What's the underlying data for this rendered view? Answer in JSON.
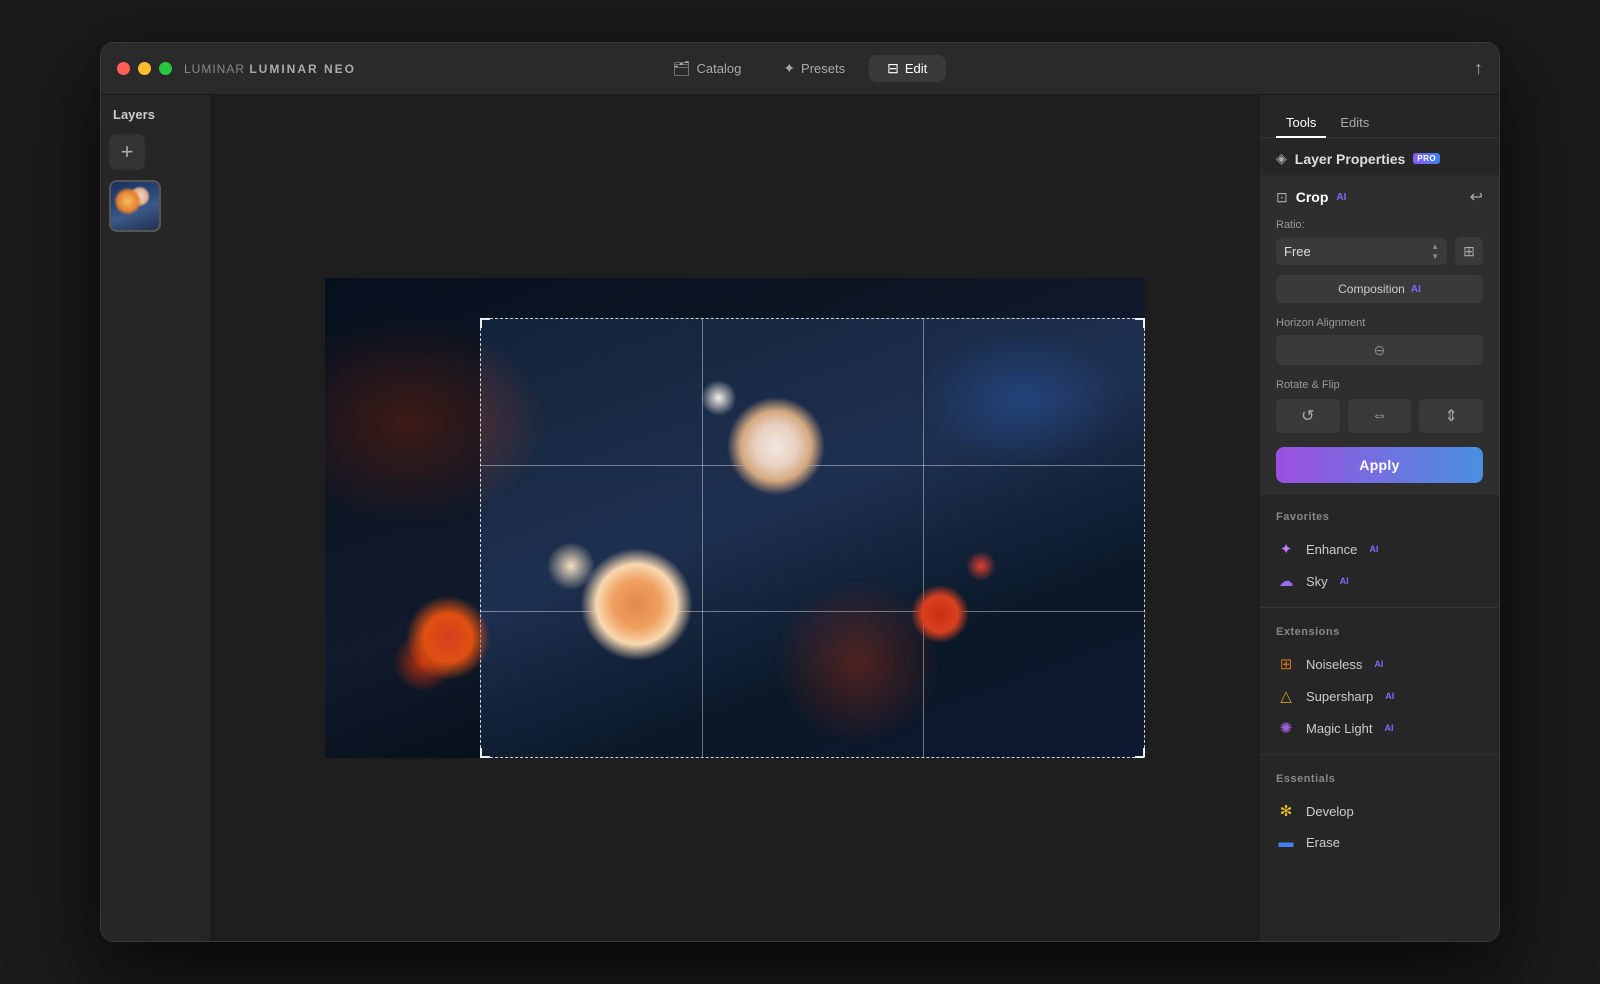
{
  "window": {
    "title": "LUMINAR NEO"
  },
  "titlebar": {
    "app_label": "LUMINAR",
    "app_name": "NEO",
    "nav": [
      {
        "id": "catalog",
        "label": "Catalog",
        "icon": "🗂",
        "active": false
      },
      {
        "id": "presets",
        "label": "Presets",
        "icon": "✦",
        "active": false
      },
      {
        "id": "edit",
        "label": "Edit",
        "icon": "⊟",
        "active": true
      }
    ],
    "share_icon": "↑"
  },
  "layers_panel": {
    "title": "Layers",
    "add_btn_label": "+"
  },
  "right_panel": {
    "tabs": [
      {
        "id": "tools",
        "label": "Tools",
        "active": true
      },
      {
        "id": "edits",
        "label": "Edits",
        "active": false
      }
    ],
    "layer_properties": {
      "title": "Layer Properties",
      "pro_badge": "PRO",
      "icon": "◈"
    },
    "crop": {
      "title": "Crop",
      "ai_badge": "AI",
      "icon": "⊡",
      "reset_icon": "↩",
      "ratio_label": "Ratio:",
      "ratio_value": "Free",
      "composition_label": "Composition",
      "composition_ai": "AI",
      "horizon_label": "Horizon Alignment",
      "rotate_flip_label": "Rotate & Flip",
      "rotate_icon": "↺",
      "flip_h_icon": "⇔",
      "flip_v_icon": "⇕",
      "apply_label": "Apply"
    },
    "favorites": {
      "title": "Favorites",
      "items": [
        {
          "id": "enhance",
          "label": "Enhance",
          "ai": true,
          "icon": "✦",
          "icon_color": "#c87aff"
        },
        {
          "id": "sky",
          "label": "Sky",
          "ai": true,
          "icon": "☁",
          "icon_color": "#9b6aee"
        }
      ]
    },
    "extensions": {
      "title": "Extensions",
      "items": [
        {
          "id": "noiseless",
          "label": "Noiseless",
          "ai": true,
          "icon": "⊞",
          "icon_color": "#c87020"
        },
        {
          "id": "supersharp",
          "label": "Supersharp",
          "ai": true,
          "icon": "△",
          "icon_color": "#d4a020"
        },
        {
          "id": "magic_light",
          "label": "Magic Light",
          "ai": true,
          "icon": "✺",
          "icon_color": "#a060e0"
        }
      ]
    },
    "essentials": {
      "title": "Essentials",
      "items": [
        {
          "id": "develop",
          "label": "Develop",
          "ai": false,
          "icon": "✻",
          "icon_color": "#f0c020"
        },
        {
          "id": "erase",
          "label": "Erase",
          "ai": false,
          "icon": "▬",
          "icon_color": "#4080f0"
        }
      ]
    }
  }
}
